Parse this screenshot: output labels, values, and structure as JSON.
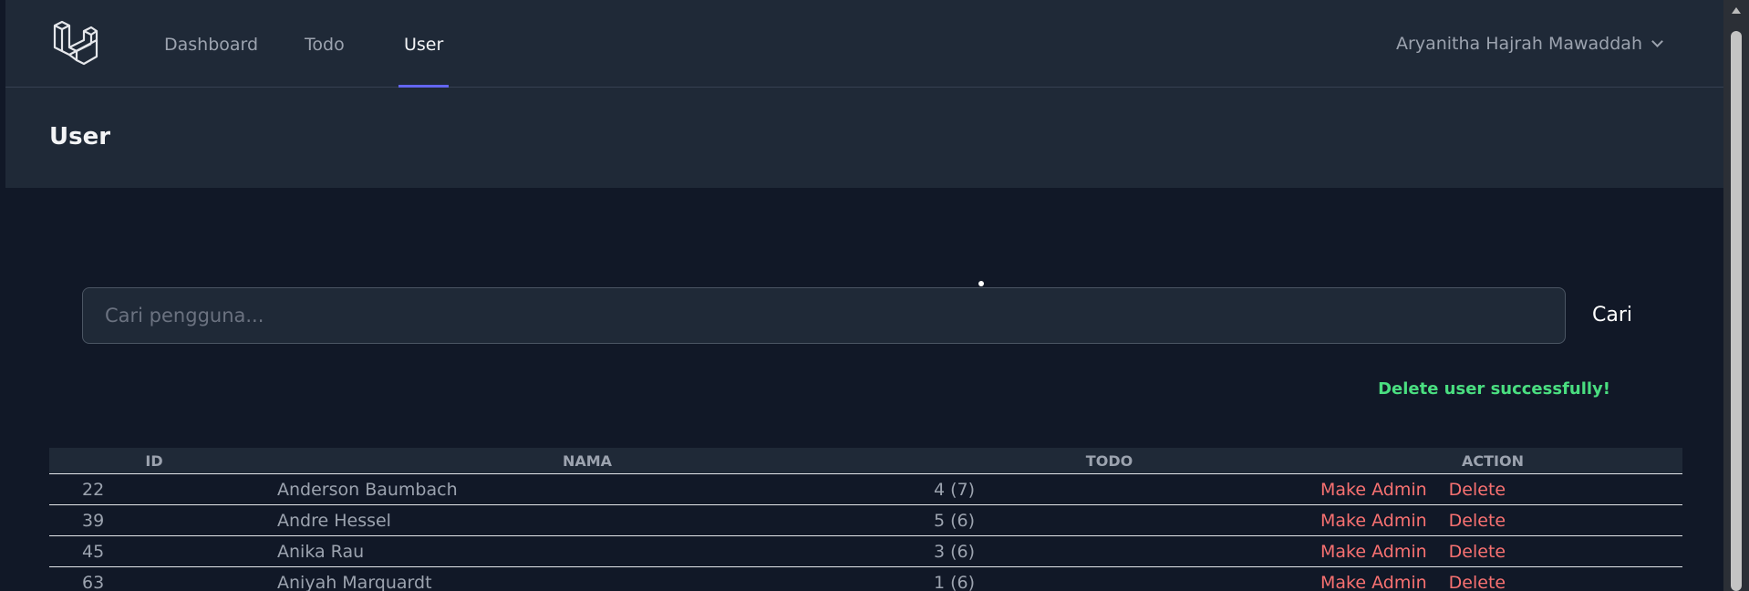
{
  "nav": {
    "logo": "laravel-logo-icon",
    "links": [
      {
        "label": "Dashboard",
        "active": false
      },
      {
        "label": "Todo",
        "active": false
      },
      {
        "label": "User",
        "active": true
      }
    ],
    "user_name": "Aryanitha Hajrah Mawaddah"
  },
  "header": {
    "title": "User"
  },
  "search": {
    "placeholder": "Cari pengguna...",
    "value": "",
    "button_label": "Cari"
  },
  "flash": {
    "message": "Delete user successfully!",
    "color": "#4ade80"
  },
  "table": {
    "headers": [
      "ID",
      "NAMA",
      "TODO",
      "ACTION"
    ],
    "rows": [
      {
        "id": "22",
        "name": "Anderson Baumbach",
        "todo": "4 (7)",
        "make_admin": "Make Admin",
        "delete": "Delete"
      },
      {
        "id": "39",
        "name": "Andre Hessel",
        "todo": "5 (6)",
        "make_admin": "Make Admin",
        "delete": "Delete"
      },
      {
        "id": "45",
        "name": "Anika Rau",
        "todo": "3 (6)",
        "make_admin": "Make Admin",
        "delete": "Delete"
      },
      {
        "id": "63",
        "name": "Aniyah Marquardt",
        "todo": "1 (6)",
        "make_admin": "Make Admin",
        "delete": "Delete"
      }
    ]
  },
  "colors": {
    "background": "#111827",
    "panel": "#1f2937",
    "accent": "#6366f1",
    "danger": "#f87171",
    "success": "#4ade80"
  }
}
